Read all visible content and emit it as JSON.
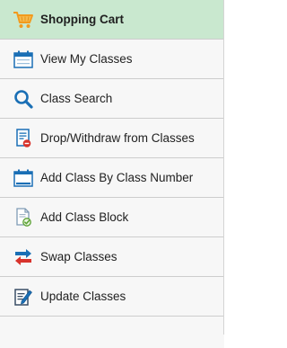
{
  "nav": {
    "items": [
      {
        "label": "Shopping Cart",
        "icon": "shopping-cart-icon",
        "active": true
      },
      {
        "label": "View My Classes",
        "icon": "calendar-icon",
        "active": false
      },
      {
        "label": "Class Search",
        "icon": "search-icon",
        "active": false
      },
      {
        "label": "Drop/Withdraw from Classes",
        "icon": "drop-document-icon",
        "active": false
      },
      {
        "label": "Add Class By Class Number",
        "icon": "calendar-icon",
        "active": false
      },
      {
        "label": "Add Class Block",
        "icon": "add-document-icon",
        "active": false
      },
      {
        "label": "Swap Classes",
        "icon": "swap-arrows-icon",
        "active": false
      },
      {
        "label": "Update Classes",
        "icon": "edit-document-icon",
        "active": false
      }
    ]
  },
  "colors": {
    "active_bg": "#c9e8cf",
    "nav_bg": "#f7f7f7",
    "divider": "#cdcdcd",
    "text": "#1f1f1f",
    "icon_blue": "#1a6fb5",
    "icon_orange": "#f29a1d",
    "icon_red": "#d8332c"
  }
}
